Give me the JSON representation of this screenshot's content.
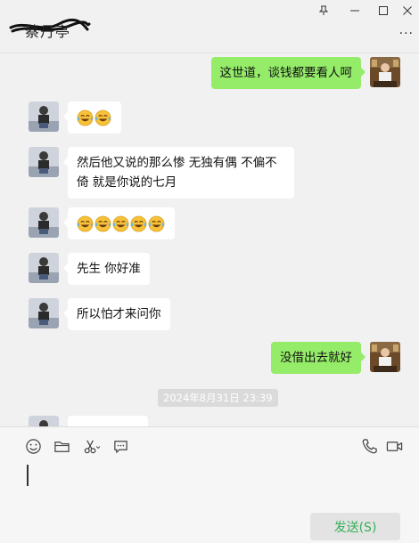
{
  "chat": {
    "contact_name": "蔡丹亭",
    "more_label": "···"
  },
  "window_buttons": {
    "pin": "pin-icon",
    "minimize": "minimize-icon",
    "maximize": "maximize-icon",
    "close": "close-icon"
  },
  "messages": [
    {
      "side": "right",
      "text": "这世道，谈钱都要看人呵"
    },
    {
      "side": "left",
      "emoji_count": 2,
      "emoji": "tears-of-joy"
    },
    {
      "side": "left",
      "line1": "然后他又说的那么惨 无独有偶 不偏不",
      "line2": "倚 就是你说的七月"
    },
    {
      "side": "left",
      "emoji_count": 5,
      "emoji": "tears-of-joy"
    },
    {
      "side": "left",
      "text": "先生 你好准"
    },
    {
      "side": "left",
      "text": "所以怕才来问你"
    },
    {
      "side": "right",
      "text": "没借出去就好"
    }
  ],
  "timestamp": "2024年8月31日 23:39",
  "toolbar": {
    "emoji": "smiley-icon",
    "folder": "folder-icon",
    "screenshot": "scissors-icon",
    "chat_history": "chat-bubble-icon",
    "voice_call": "phone-icon",
    "video_call": "video-camera-icon"
  },
  "input": {
    "value": ""
  },
  "send_button_label": "发送(S)",
  "colors": {
    "self_bubble": "#95ec69",
    "other_bubble": "#ffffff",
    "send_text": "#37b05a"
  }
}
